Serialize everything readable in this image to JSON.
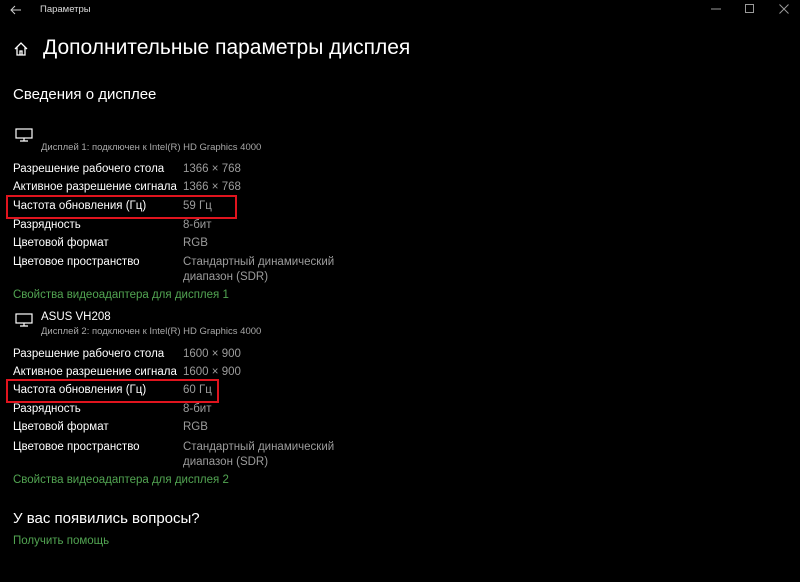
{
  "window": {
    "title": "Параметры",
    "back_icon": "back-arrow-icon",
    "buttons": [
      "minimize-icon",
      "maximize-icon",
      "close-icon"
    ]
  },
  "page": {
    "title": "Дополнительные параметры дисплея",
    "home_icon": "home-icon"
  },
  "section": {
    "title": "Сведения о дисплее"
  },
  "displays": [
    {
      "name": "",
      "subtitle": "Дисплей 1: подключен к Intel(R) HD Graphics 4000",
      "properties": [
        {
          "label": "Разрешение рабочего стола",
          "value": "1366 × 768"
        },
        {
          "label": "Активное разрешение сигнала",
          "value": "1366 × 768"
        },
        {
          "label": "Частота обновления (Гц)",
          "value": "59 Гц"
        },
        {
          "label": "Разрядность",
          "value": "8-бит"
        },
        {
          "label": "Цветовой формат",
          "value": "RGB"
        },
        {
          "label": "Цветовое пространство",
          "value_line1": "Стандартный динамический",
          "value_line2": "диапазон (SDR)"
        }
      ],
      "adapter_link": "Свойства видеоадаптера для дисплея 1"
    },
    {
      "name": "ASUS VH208",
      "subtitle": "Дисплей 2: подключен к Intel(R) HD Graphics 4000",
      "properties": [
        {
          "label": "Разрешение рабочего стола",
          "value": "1600 × 900"
        },
        {
          "label": "Активное разрешение сигнала",
          "value": "1600 × 900"
        },
        {
          "label": "Частота обновления (Гц)",
          "value": "60 Гц"
        },
        {
          "label": "Разрядность",
          "value": "8-бит"
        },
        {
          "label": "Цветовой формат",
          "value": "RGB"
        },
        {
          "label": "Цветовое пространство",
          "value_line1": "Стандартный динамический",
          "value_line2": "диапазон (SDR)"
        }
      ],
      "adapter_link": "Свойства видеоадаптера для дисплея 2"
    }
  ],
  "questions": {
    "title": "У вас появились вопросы?",
    "help_link": "Получить помощь"
  },
  "colors": {
    "background": "#000000",
    "text": "#ffffff",
    "secondary_text": "#9c9c9c",
    "link": "#52a552",
    "highlight": "#e0141e"
  }
}
